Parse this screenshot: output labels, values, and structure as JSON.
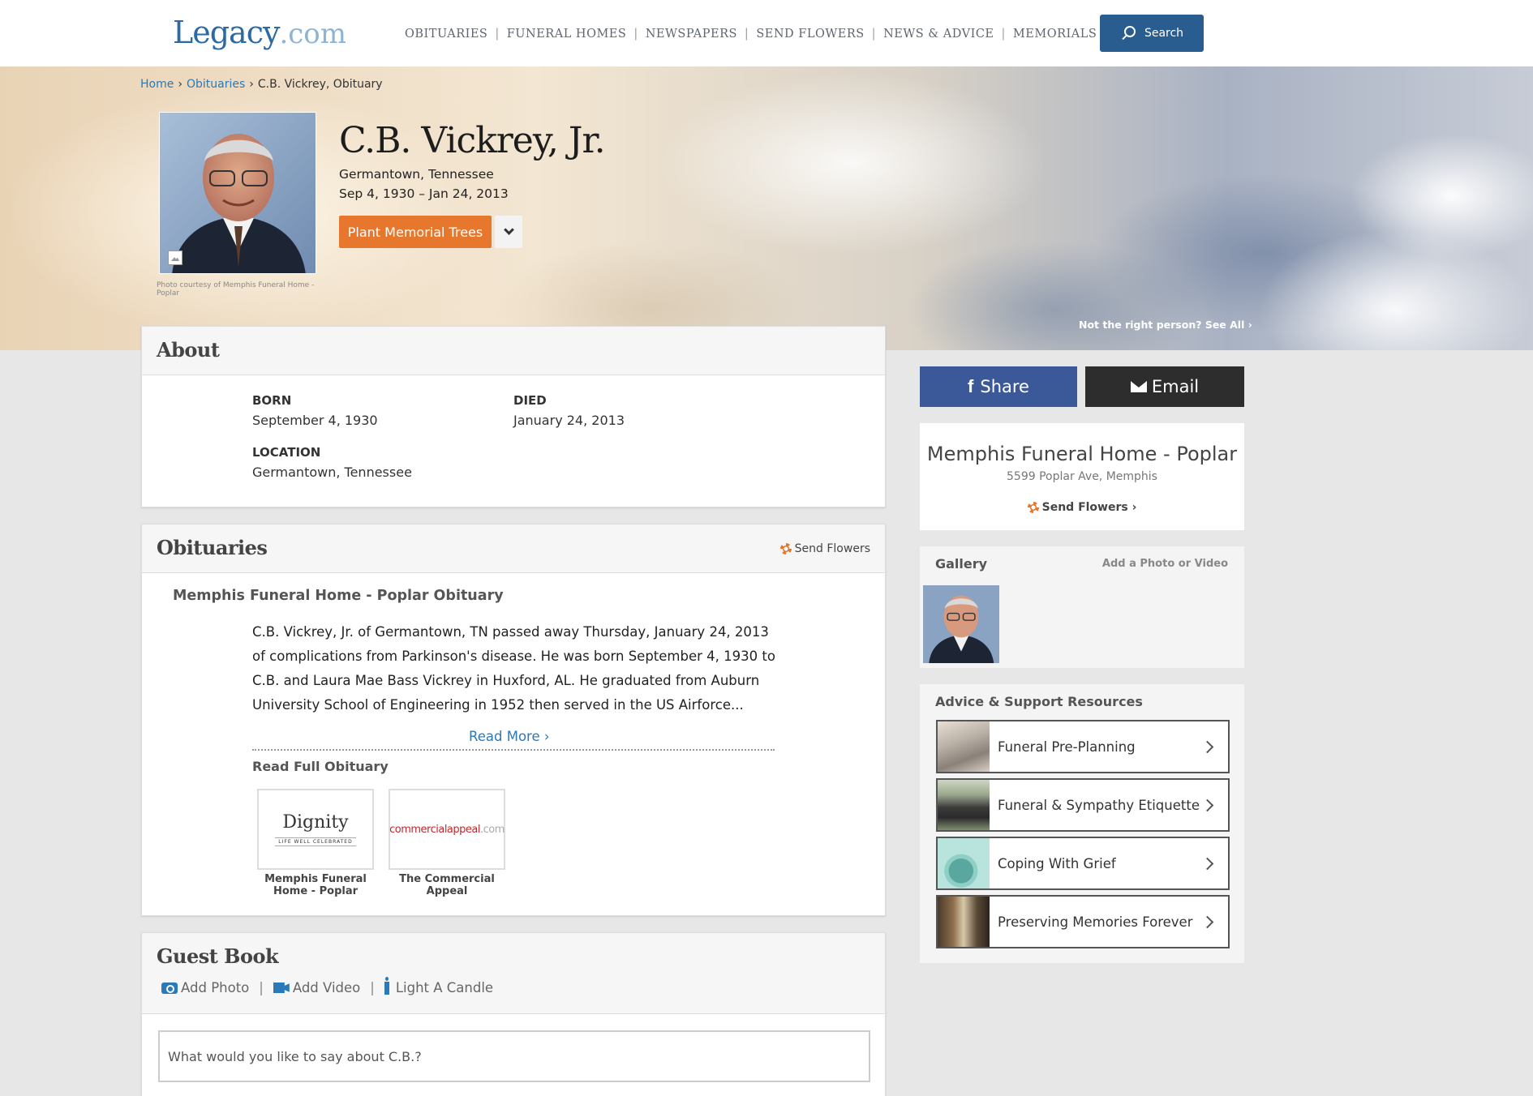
{
  "header": {
    "logo_main": "Legacy",
    "logo_suffix": ".com",
    "nav": [
      "OBITUARIES",
      "FUNERAL HOMES",
      "NEWSPAPERS",
      "SEND FLOWERS",
      "NEWS & ADVICE",
      "MEMORIALS"
    ],
    "search_label": "Search"
  },
  "breadcrumb": {
    "home": "Home",
    "obituaries": "Obituaries",
    "current": "C.B. Vickrey, Obituary"
  },
  "hero": {
    "photo_credit": "Photo courtesy of Memphis Funeral Home - Poplar",
    "name": "C.B. Vickrey, Jr.",
    "place": "Germantown, Tennessee",
    "dates": "Sep 4, 1930 – Jan 24, 2013",
    "plant_button": "Plant Memorial Trees",
    "not_right": "Not the right person? See All ›"
  },
  "about": {
    "title": "About",
    "born_label": "BORN",
    "born_value": "September 4, 1930",
    "died_label": "DIED",
    "died_value": "January 24, 2013",
    "location_label": "LOCATION",
    "location_value": "Germantown, Tennessee"
  },
  "obituaries": {
    "title": "Obituaries",
    "send_flowers": "Send Flowers",
    "subtitle": "Memphis Funeral Home - Poplar Obituary",
    "body": "C.B. Vickrey, Jr. of Germantown, TN passed away Thursday, January 24, 2013 of complications from Parkinson's disease. He was born September 4, 1930 to C.B. and Laura Mae Bass Vickrey in Huxford, AL. He graduated from Auburn University School of Engineering in 1952 then served in the US Airforce...",
    "read_more": "Read More ›",
    "read_full": "Read Full Obituary",
    "sources": [
      {
        "logo_main": "Dignity",
        "logo_tag": "LIFE WELL CELEBRATED",
        "label": "Memphis Funeral Home - Poplar"
      },
      {
        "logo_main": "commercialappeal",
        "logo_suffix": ".com",
        "label": "The Commercial Appeal"
      }
    ]
  },
  "guestbook": {
    "title": "Guest Book",
    "add_photo": "Add Photo",
    "add_video": "Add Video",
    "light_candle": "Light A Candle",
    "placeholder": "What would you like to say about C.B.?"
  },
  "share": {
    "share_label": "Share",
    "email_label": "Email"
  },
  "funeral_home": {
    "name": "Memphis Funeral Home - Poplar",
    "address": "5599 Poplar Ave, Memphis",
    "send_flowers": "Send Flowers ›"
  },
  "gallery": {
    "title": "Gallery",
    "add": "Add a Photo or Video"
  },
  "advice": {
    "title": "Advice & Support Resources",
    "items": [
      {
        "label": "Funeral Pre-Planning"
      },
      {
        "label": "Funeral & Sympathy Etiquette"
      },
      {
        "label": "Coping With Grief"
      },
      {
        "label": "Preserving Memories Forever"
      }
    ]
  },
  "colors": {
    "brand_blue": "#2a5d8f",
    "link_blue": "#2a79b8",
    "orange": "#e8772e",
    "facebook": "#3b5998"
  }
}
